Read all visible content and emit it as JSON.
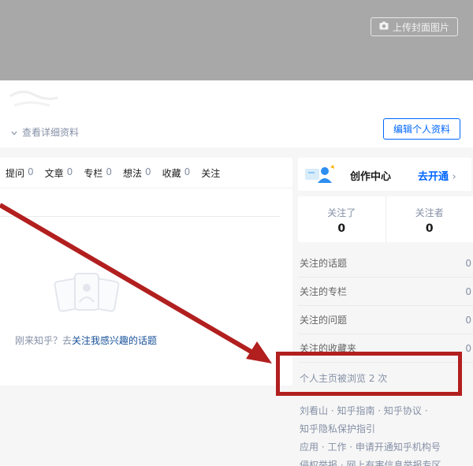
{
  "cover": {
    "upload_label": "上传封面图片"
  },
  "profile": {
    "detail_label": "查看详细资料",
    "edit_label": "编辑个人资料"
  },
  "tabs": [
    {
      "label": "提问",
      "count": "0"
    },
    {
      "label": "文章",
      "count": "0"
    },
    {
      "label": "专栏",
      "count": "0"
    },
    {
      "label": "想法",
      "count": "0"
    },
    {
      "label": "收藏",
      "count": "0"
    },
    {
      "label": "关注",
      "count": ""
    }
  ],
  "empty": {
    "prefix": "刚来知乎？去",
    "link": "关注我感兴趣的话题"
  },
  "creator": {
    "title": "创作中心",
    "open_label": "去开通"
  },
  "follow": {
    "following_label": "关注了",
    "following_value": "0",
    "followers_label": "关注者",
    "followers_value": "0"
  },
  "stats": [
    {
      "label": "关注的话题",
      "value": "0"
    },
    {
      "label": "关注的专栏",
      "value": "0"
    },
    {
      "label": "关注的问题",
      "value": "0"
    },
    {
      "label": "关注的收藏夹",
      "value": "0"
    }
  ],
  "views_text": "个人主页被浏览 2 次",
  "footer": {
    "line1": "刘看山 · 知乎指南 · 知乎协议 ·",
    "line2": "知乎隐私保护指引",
    "line3": "应用 · 工作 · 申请开通知乎机构号",
    "line4": "侵权举报 · 网上有害信息举报专区"
  },
  "colors": {
    "accent": "#0066ff",
    "annotation": "#b21f1f",
    "cover": "#a8a8a8"
  }
}
